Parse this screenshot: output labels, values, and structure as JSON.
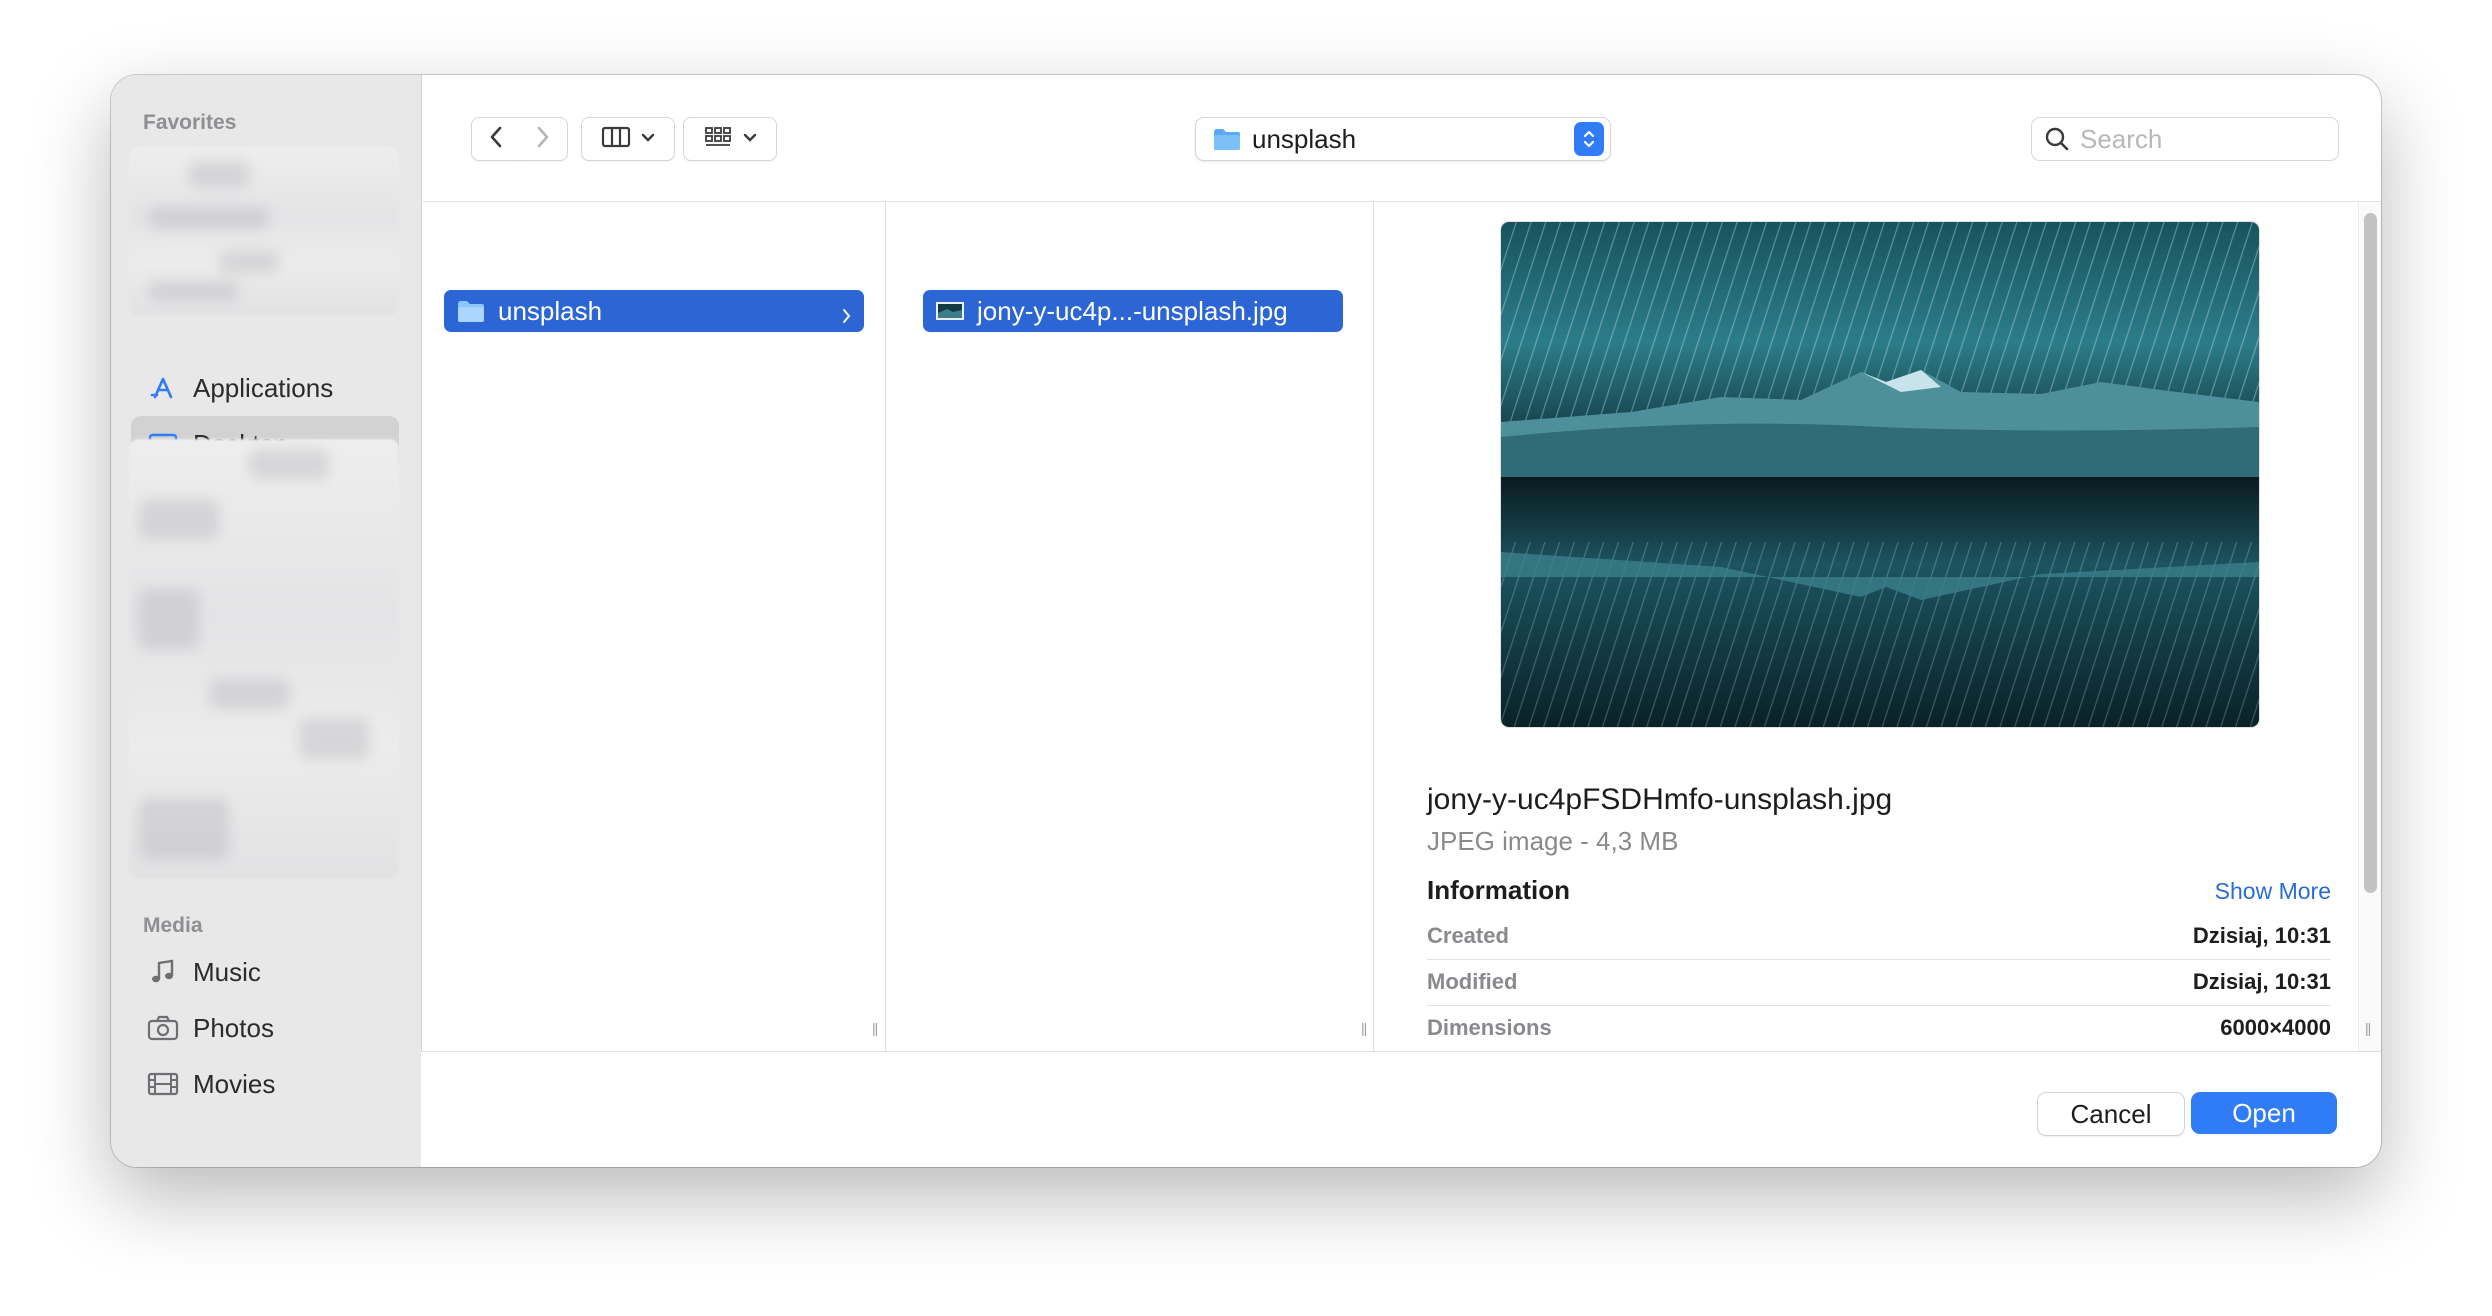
{
  "sidebar": {
    "favorites_heading": "Favorites",
    "favorites": [
      {
        "label": "Applications",
        "icon": "applications-icon",
        "selected": false
      },
      {
        "label": "Desktop",
        "icon": "desktop-icon",
        "selected": true
      }
    ],
    "media_heading": "Media",
    "media": [
      {
        "label": "Music",
        "icon": "music-note-icon"
      },
      {
        "label": "Photos",
        "icon": "camera-icon"
      },
      {
        "label": "Movies",
        "icon": "film-icon"
      }
    ]
  },
  "toolbar": {
    "back": "back-chevron-icon",
    "forward": "forward-chevron-icon",
    "view_mode": "column-view-icon",
    "group_mode": "grid-icon",
    "location": "unsplash",
    "search_placeholder": "Search"
  },
  "columns": [
    {
      "selected_item": "unsplash",
      "kind": "folder"
    },
    {
      "selected_item": "jony-y-uc4p...-unsplash.jpg",
      "kind": "image"
    }
  ],
  "preview": {
    "filename": "jony-y-uc4pFSDHmfo-unsplash.jpg",
    "subtitle": "JPEG image - 4,3 MB",
    "info_heading": "Information",
    "show_more": "Show More",
    "rows": [
      {
        "key": "Created",
        "value": "Dzisiaj, 10:31"
      },
      {
        "key": "Modified",
        "value": "Dzisiaj, 10:31"
      },
      {
        "key": "Dimensions",
        "value": "6000×4000"
      }
    ]
  },
  "footer": {
    "cancel": "Cancel",
    "open": "Open"
  },
  "colors": {
    "accent": "#2f7cf6",
    "selection": "#2c65d4",
    "sidebar_bg": "#e8e8e8"
  }
}
